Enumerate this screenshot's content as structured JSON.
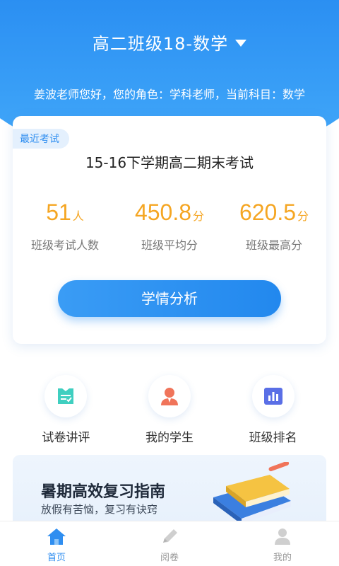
{
  "header": {
    "class_selector": "高二班级18-数学",
    "greeting": "姜波老师您好，您的角色：学科老师，当前科目：数学"
  },
  "recent_exam": {
    "badge": "最近考试",
    "title": "15-16下学期高二期末考试",
    "stats": [
      {
        "value": "51",
        "unit": "人",
        "label": "班级考试人数"
      },
      {
        "value": "450.8",
        "unit": "分",
        "label": "班级平均分"
      },
      {
        "value": "620.5",
        "unit": "分",
        "label": "班级最高分"
      }
    ],
    "analysis_button": "学情分析"
  },
  "quick_actions": [
    {
      "label": "试卷讲评",
      "icon": "paper-review-icon"
    },
    {
      "label": "我的学生",
      "icon": "student-icon"
    },
    {
      "label": "班级排名",
      "icon": "ranking-chart-icon"
    }
  ],
  "banner": {
    "title": "暑期高效复习指南",
    "subtitle": "放假有苦恼，复习有诀窍"
  },
  "tabbar": [
    {
      "label": "首页",
      "icon": "home-icon",
      "active": true
    },
    {
      "label": "阅卷",
      "icon": "pencil-icon",
      "active": false
    },
    {
      "label": "我的",
      "icon": "profile-icon",
      "active": false
    }
  ],
  "colors": {
    "primary": "#2f8ef0",
    "accent_orange": "#f5a623",
    "teal": "#3fcfc0",
    "coral": "#f0745a",
    "indigo": "#5a6fe6"
  }
}
